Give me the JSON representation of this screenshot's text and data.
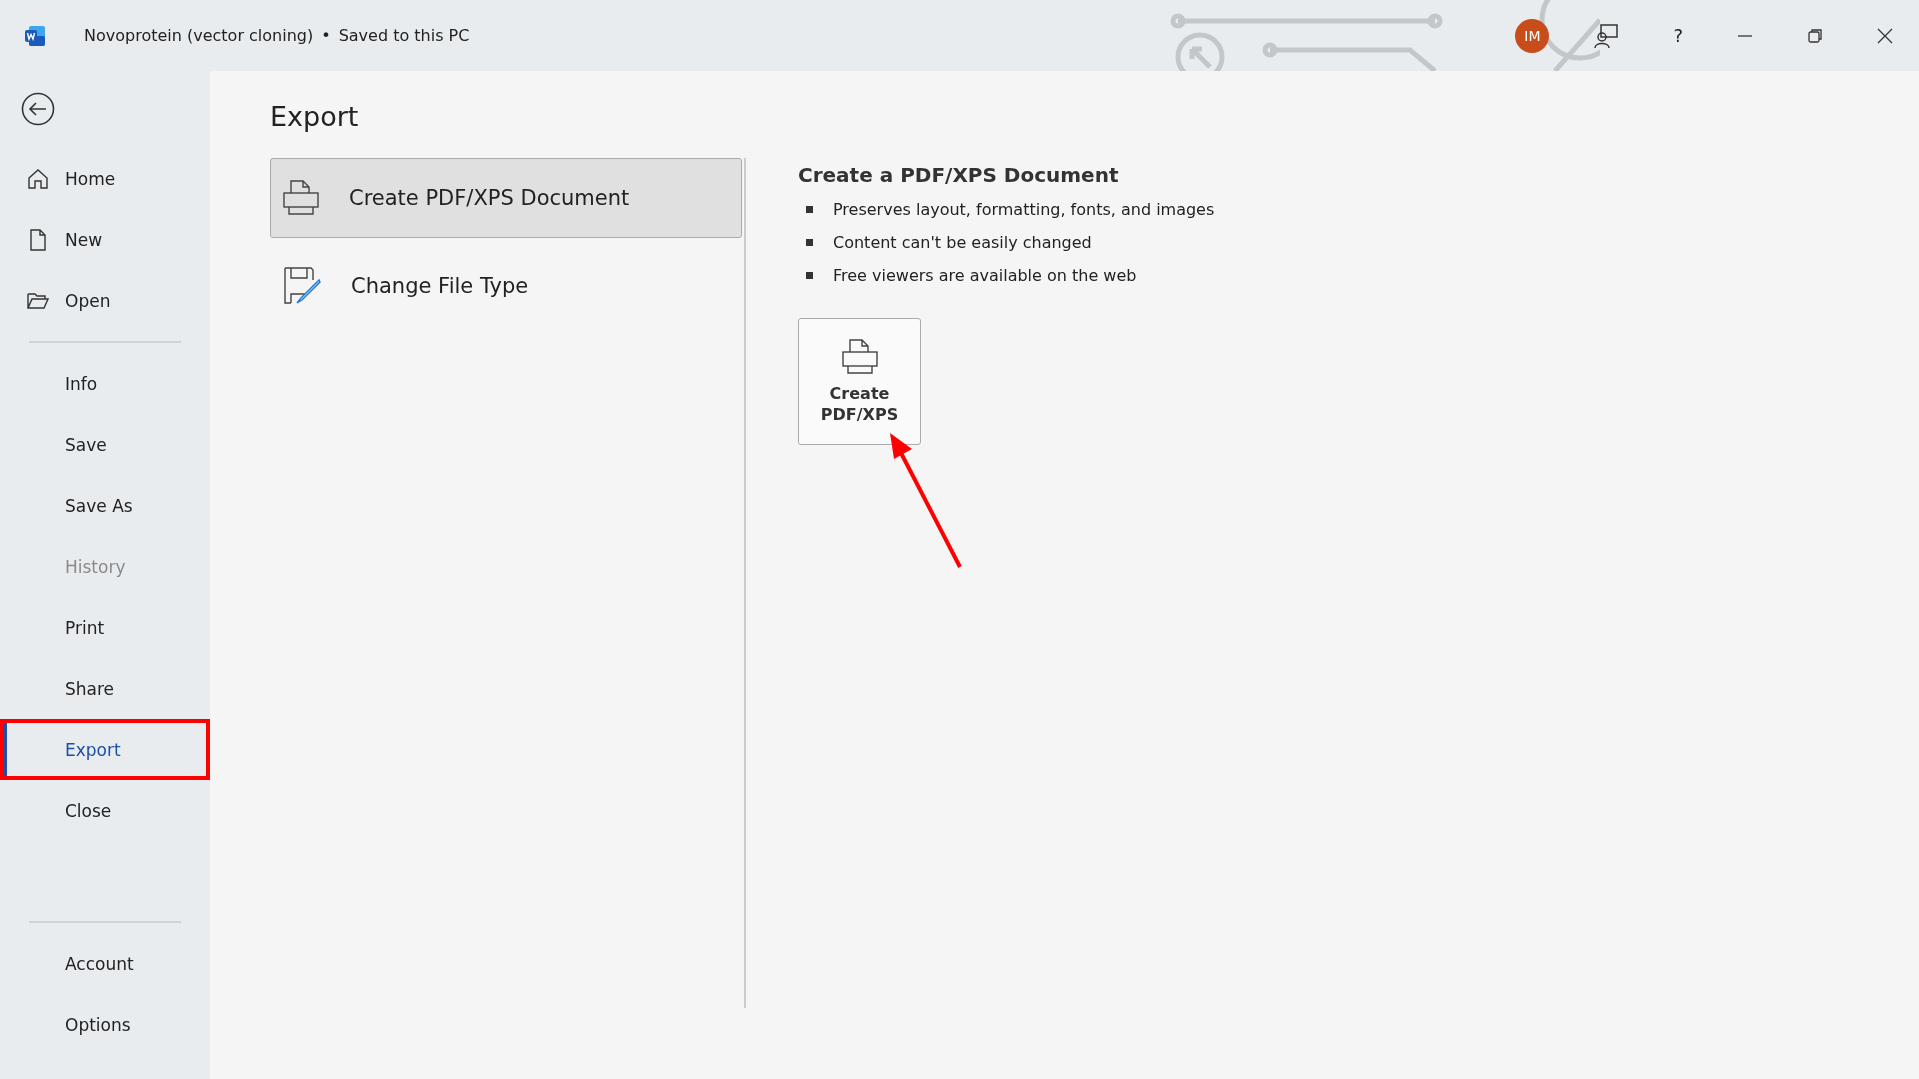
{
  "window": {
    "title": "Novoprotein (vector cloning)",
    "save_status": "Saved to this PC",
    "separator": "•",
    "avatar_initials": "IM",
    "help": "?"
  },
  "sidebar": {
    "top_items": [
      {
        "label": "Home",
        "kind": "home",
        "selected": false,
        "disabled": false
      },
      {
        "label": "New",
        "kind": "document",
        "selected": false,
        "disabled": false
      },
      {
        "label": "Open",
        "kind": "folder",
        "selected": false,
        "disabled": false
      }
    ],
    "middle_items": [
      {
        "label": "Info",
        "selected": false,
        "disabled": false
      },
      {
        "label": "Save",
        "selected": false,
        "disabled": false
      },
      {
        "label": "Save As",
        "selected": false,
        "disabled": false
      },
      {
        "label": "History",
        "selected": false,
        "disabled": true
      },
      {
        "label": "Print",
        "selected": false,
        "disabled": false
      },
      {
        "label": "Share",
        "selected": false,
        "disabled": false
      },
      {
        "label": "Export",
        "selected": true,
        "disabled": false
      },
      {
        "label": "Close",
        "selected": false,
        "disabled": false
      }
    ],
    "bottom_items": [
      {
        "label": "Account",
        "selected": false,
        "disabled": false
      },
      {
        "label": "Options",
        "selected": false,
        "disabled": false
      }
    ]
  },
  "page": {
    "title": "Export",
    "options": [
      {
        "label": "Create PDF/XPS Document",
        "kind": "printer",
        "selected": true
      },
      {
        "label": "Change File Type",
        "kind": "file-pen",
        "selected": false
      }
    ],
    "detail": {
      "title": "Create a PDF/XPS Document",
      "bullets": [
        "Preserves layout, formatting, fonts, and images",
        "Content can't be easily changed",
        "Free viewers are available on the web"
      ],
      "button": "Create PDF/XPS"
    }
  }
}
